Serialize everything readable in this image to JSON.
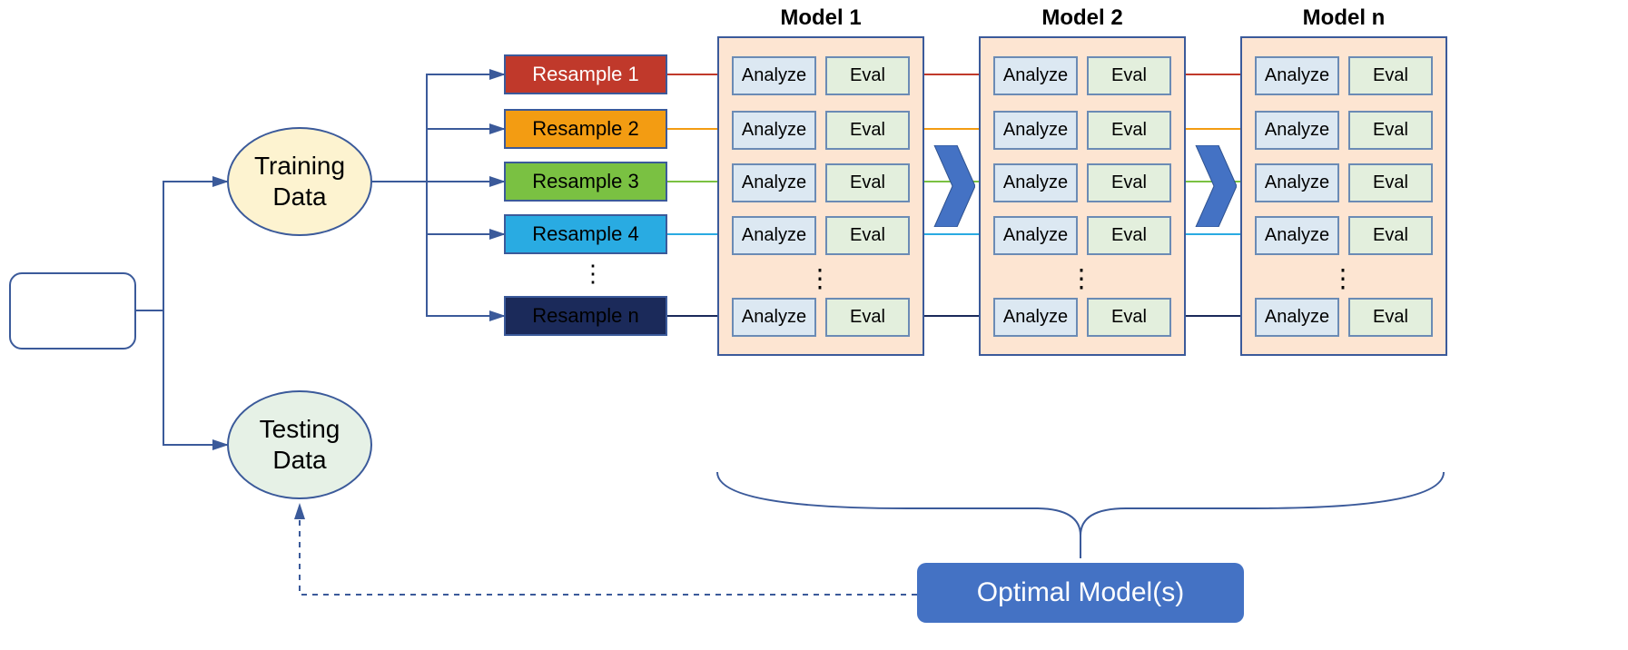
{
  "nodes": {
    "dataset_label": "",
    "training_label": "Training\nData",
    "testing_label": "Testing\nData"
  },
  "resamples": [
    {
      "label": "Resample 1",
      "class": "r1",
      "color": "#c0392b"
    },
    {
      "label": "Resample 2",
      "class": "r2",
      "color": "#f39c12"
    },
    {
      "label": "Resample 3",
      "class": "r3",
      "color": "#7ac142"
    },
    {
      "label": "Resample 4",
      "class": "r4",
      "color": "#29abe2"
    },
    {
      "label": "Resample n",
      "class": "rn",
      "color": "#1b2a5a"
    }
  ],
  "models": [
    {
      "title": "Model 1"
    },
    {
      "title": "Model 2"
    },
    {
      "title": "Model n"
    }
  ],
  "row_labels": {
    "analyze": "Analyze",
    "eval": "Eval"
  },
  "optimal_label": "Optimal Model(s)",
  "vdots": "⋮"
}
